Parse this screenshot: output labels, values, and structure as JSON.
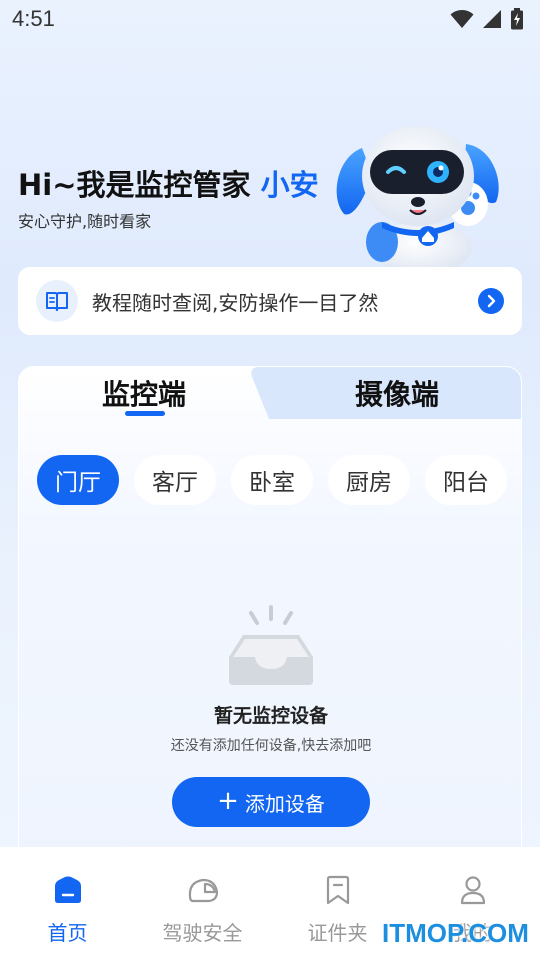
{
  "status_bar": {
    "time": "4:51"
  },
  "hero": {
    "title_prefix": "Hi~我是监控管家",
    "title_name": "小安",
    "subtitle": "安心守护,随时看家"
  },
  "tutorial": {
    "text": "教程随时查阅,安防操作一目了然"
  },
  "tabs": [
    {
      "label": "监控端",
      "active": true
    },
    {
      "label": "摄像端",
      "active": false
    }
  ],
  "rooms": [
    {
      "label": "门厅",
      "active": true
    },
    {
      "label": "客厅",
      "active": false
    },
    {
      "label": "卧室",
      "active": false
    },
    {
      "label": "厨房",
      "active": false
    },
    {
      "label": "阳台",
      "active": false
    }
  ],
  "empty_state": {
    "title": "暂无监控设备",
    "subtitle": "还没有添加任何设备,快去添加吧",
    "button_icon": "+",
    "button_label": "添加设备"
  },
  "bottom_nav": [
    {
      "label": "首页",
      "icon": "home-icon",
      "active": true
    },
    {
      "label": "驾驶安全",
      "icon": "helmet-icon",
      "active": false
    },
    {
      "label": "证件夹",
      "icon": "bookmark-icon",
      "active": false
    },
    {
      "label": "我的",
      "icon": "person-icon",
      "active": false
    }
  ],
  "watermark": "ITMOP.COM",
  "colors": {
    "accent": "#1266f1",
    "inactive": "#999999"
  }
}
